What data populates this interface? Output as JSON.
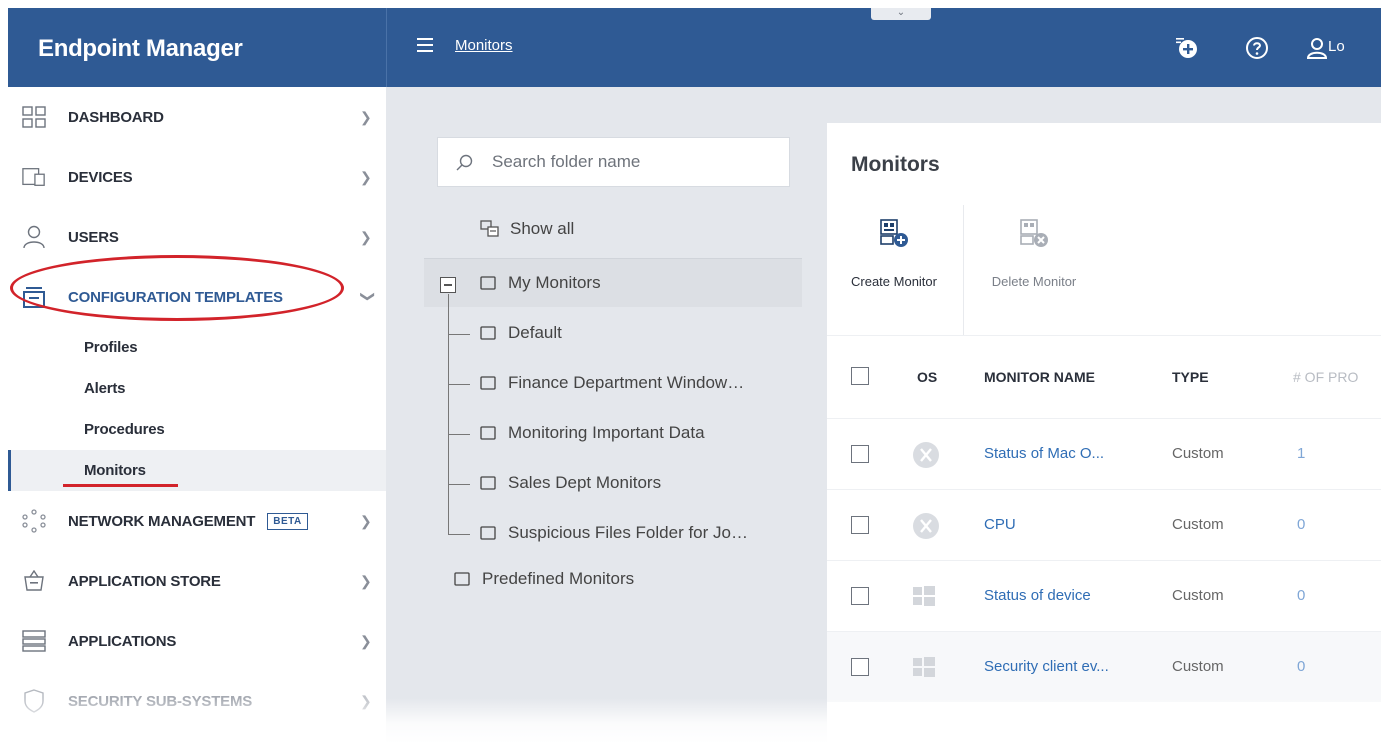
{
  "app": {
    "title": "Endpoint Manager"
  },
  "topbar": {
    "breadcrumb": "Monitors",
    "login_label": "Lo"
  },
  "sidebar": {
    "items": [
      {
        "label": "DASHBOARD",
        "icon": "dashboard-icon"
      },
      {
        "label": "DEVICES",
        "icon": "devices-icon"
      },
      {
        "label": "USERS",
        "icon": "user-icon"
      },
      {
        "label": "CONFIGURATION TEMPLATES",
        "icon": "templates-icon"
      },
      {
        "label": "NETWORK MANAGEMENT",
        "icon": "network-icon",
        "badge": "BETA"
      },
      {
        "label": "APPLICATION STORE",
        "icon": "store-icon"
      },
      {
        "label": "APPLICATIONS",
        "icon": "applications-icon"
      },
      {
        "label": "SECURITY SUB-SYSTEMS",
        "icon": "shield-icon"
      }
    ],
    "subitems": [
      "Profiles",
      "Alerts",
      "Procedures",
      "Monitors"
    ],
    "active_subitem": "Monitors"
  },
  "folders": {
    "search_placeholder": "Search folder name",
    "show_all": "Show all",
    "root": "My Monitors",
    "children": [
      "Default",
      "Finance Department Window…",
      "Monitoring Important Data",
      "Sales Dept Monitors",
      "Suspicious Files Folder for Jo…"
    ],
    "predefined": "Predefined Monitors"
  },
  "main": {
    "title": "Monitors",
    "toolbar": {
      "create": "Create Monitor",
      "delete": "Delete Monitor"
    },
    "columns": {
      "os": "OS",
      "name": "MONITOR NAME",
      "type": "TYPE",
      "count": "# OF PRO"
    },
    "rows": [
      {
        "os": "mac",
        "name": "Status of Mac O...",
        "type": "Custom",
        "count": "1"
      },
      {
        "os": "mac",
        "name": "CPU",
        "type": "Custom",
        "count": "0"
      },
      {
        "os": "windows",
        "name": "Status of device",
        "type": "Custom",
        "count": "0"
      },
      {
        "os": "windows",
        "name": "Security client ev...",
        "type": "Custom",
        "count": "0"
      }
    ]
  },
  "colors": {
    "brand": "#2f5a94",
    "highlight_red": "#d2232a",
    "link": "#2f6db5"
  }
}
